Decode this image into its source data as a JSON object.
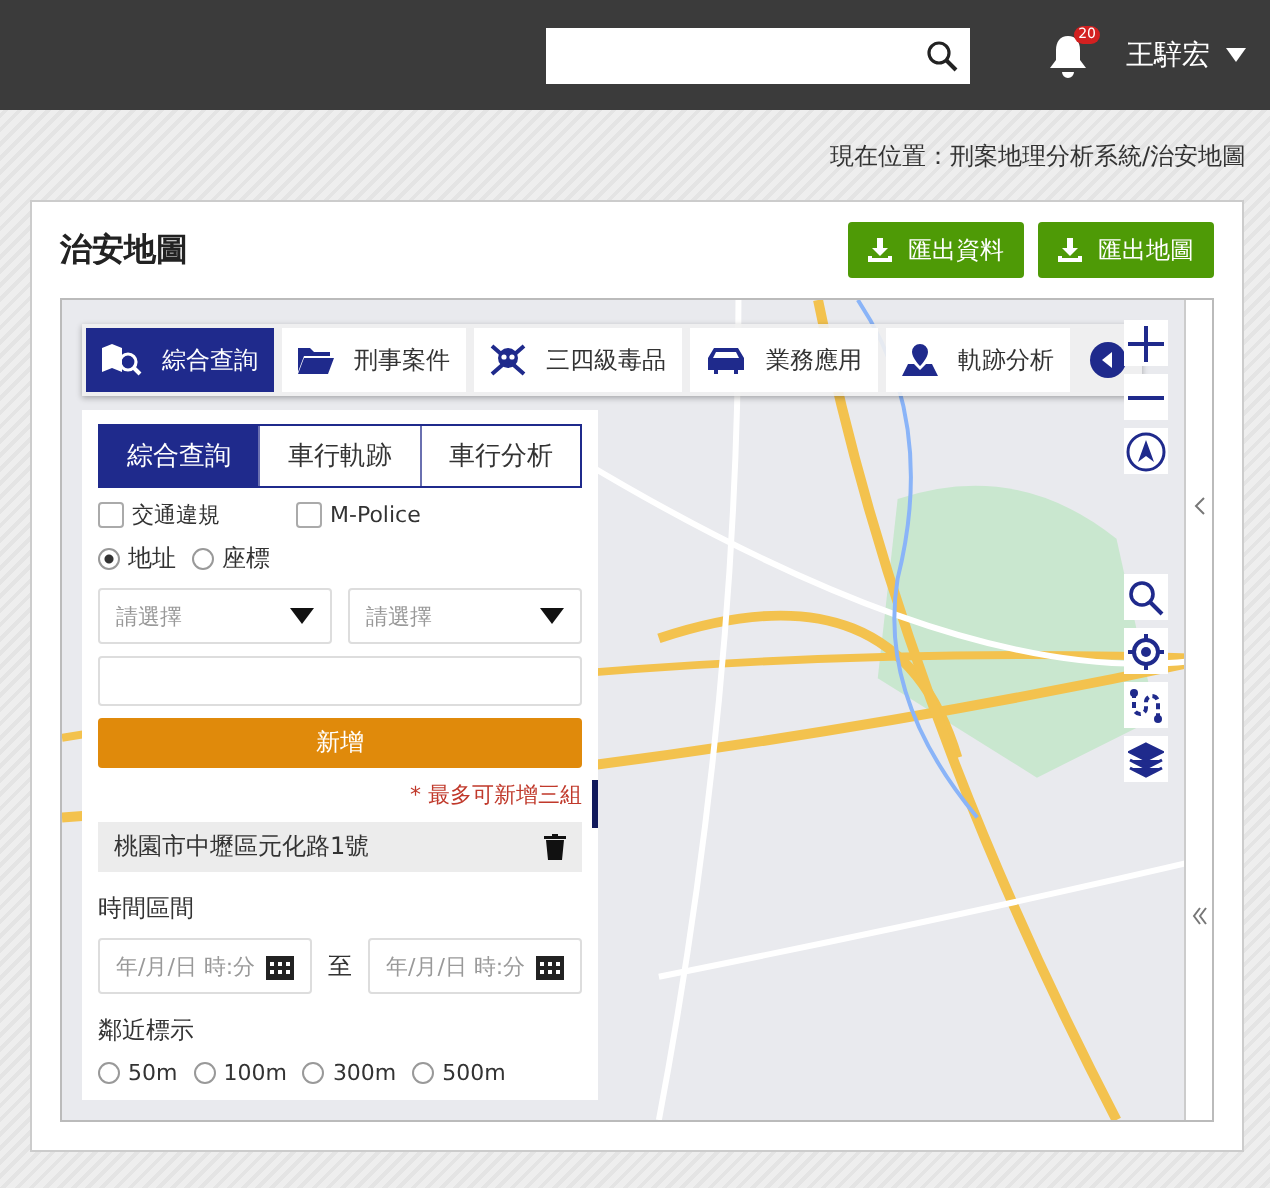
{
  "header": {
    "notification_count": "20",
    "user_name": "王騂宏"
  },
  "breadcrumb": "現在位置：刑案地理分析系統/治安地圖",
  "page_title": "治安地圖",
  "export_buttons": [
    {
      "label": "匯出資料"
    },
    {
      "label": "匯出地圖"
    }
  ],
  "map_tabs": [
    {
      "label": "綜合查詢",
      "kind": "map-search",
      "selected": true
    },
    {
      "label": "刑事案件",
      "kind": "folder",
      "selected": false
    },
    {
      "label": "三四級毒品",
      "kind": "skull",
      "selected": false
    },
    {
      "label": "業務應用",
      "kind": "car",
      "selected": false
    },
    {
      "label": "軌跡分析",
      "kind": "pin",
      "selected": false
    }
  ],
  "panel": {
    "tabs": [
      {
        "label": "綜合查詢",
        "selected": true
      },
      {
        "label": "車行軌跡",
        "selected": false
      },
      {
        "label": "車行分析",
        "selected": false
      }
    ],
    "checkboxes": [
      {
        "label": "交通違規",
        "checked": false
      },
      {
        "label": "M-Police",
        "checked": false
      }
    ],
    "location_types": [
      {
        "label": "地址",
        "selected": true
      },
      {
        "label": "座標",
        "selected": false
      }
    ],
    "selects": [
      {
        "placeholder": "請選擇"
      },
      {
        "placeholder": "請選擇"
      }
    ],
    "add_button": "新增",
    "note": "* 最多可新增三組",
    "addresses": [
      "桃園市中壢區元化路1號"
    ],
    "time_range": {
      "label": "時間區間",
      "from_placeholder": "年/月/日 時:分",
      "separator": "至",
      "to_placeholder": "年/月/日 時:分"
    },
    "proximity": {
      "label": "鄰近標示",
      "options": [
        {
          "label": "50m",
          "selected": false
        },
        {
          "label": "100m",
          "selected": false
        },
        {
          "label": "300m",
          "selected": false
        },
        {
          "label": "500m",
          "selected": false
        }
      ]
    }
  }
}
